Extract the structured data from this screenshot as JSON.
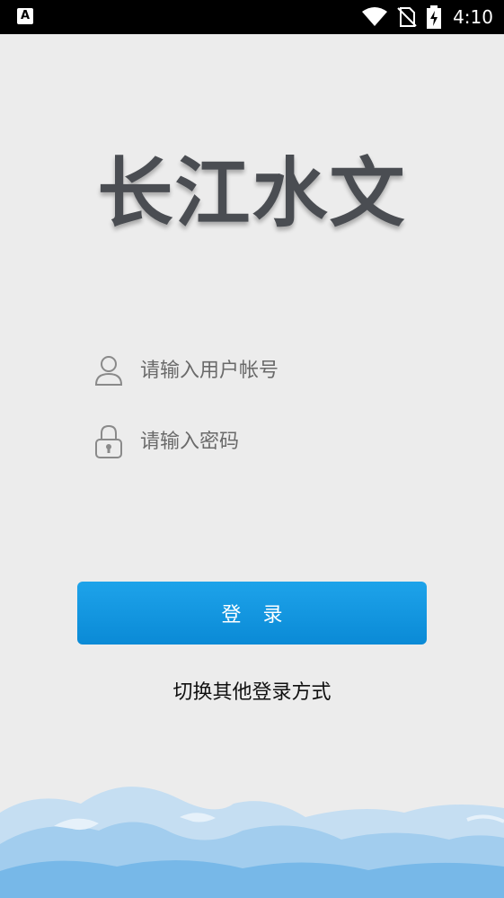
{
  "status_bar": {
    "left_icon_letter": "A",
    "icons": [
      "wifi-icon",
      "no-sim-icon",
      "battery-charging-icon"
    ],
    "time": "4:10"
  },
  "logo_text": "长江水文",
  "form": {
    "username": {
      "placeholder": "请输入用户帐号",
      "value": "",
      "icon": "user-icon"
    },
    "password": {
      "placeholder": "请输入密码",
      "value": "",
      "icon": "lock-icon"
    }
  },
  "login_button_label": "登录",
  "switch_login_label": "切换其他登录方式",
  "colors": {
    "accent": "#1a9be5",
    "background": "#ececec",
    "wave_light": "#bcdaf1",
    "wave_dark": "#6db4e8"
  }
}
